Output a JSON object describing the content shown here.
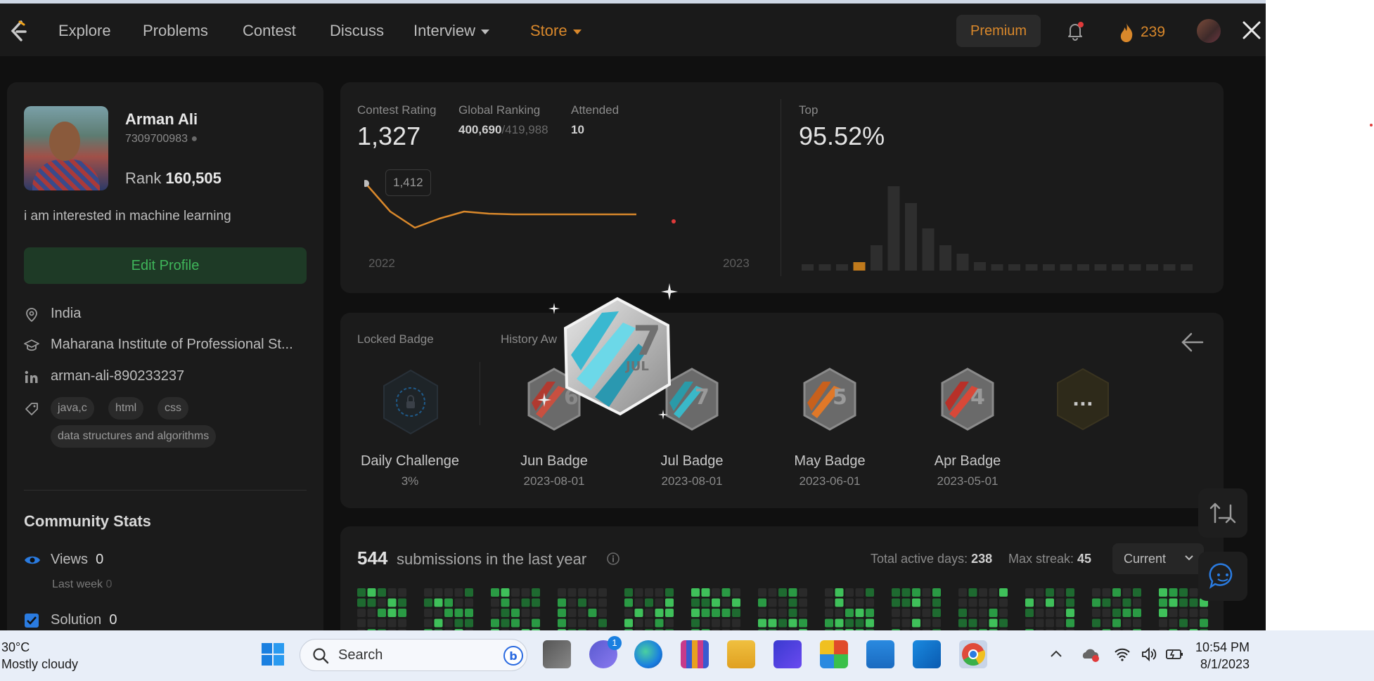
{
  "nav": {
    "items": [
      "Explore",
      "Problems",
      "Contest",
      "Discuss",
      "Interview",
      "Store"
    ],
    "premium": "Premium",
    "streak": "239"
  },
  "profile": {
    "name": "Arman Ali",
    "id": "7309700983",
    "rank_label": "Rank",
    "rank": "160,505",
    "bio": "i am interested in machine learning",
    "edit": "Edit Profile",
    "location": "India",
    "school": "Maharana Institute of Professional St...",
    "linkedin": "arman-ali-890233237",
    "tags": [
      "java,c",
      "html",
      "css",
      "data structures and algorithms"
    ],
    "community_title": "Community Stats",
    "views_label": "Views",
    "views": "0",
    "last_week": "Last week",
    "last_week_val": "0",
    "solution_label": "Solution",
    "solution": "0"
  },
  "contest": {
    "rating_label": "Contest Rating",
    "rating": "1,327",
    "ranking_label": "Global Ranking",
    "ranking": "400,690",
    "ranking_total": "/419,988",
    "attended_label": "Attended",
    "attended": "10",
    "top_label": "Top",
    "top": "95.52%",
    "tooltip": "1,412",
    "year_start": "2022",
    "year_end": "2023",
    "line_points": [
      1412,
      1372,
      1349,
      1362,
      1372,
      1369,
      1368,
      1368,
      1368,
      1368,
      1368,
      1368,
      1327
    ],
    "histogram": [
      1,
      1,
      1,
      2,
      6,
      20,
      16,
      10,
      6,
      4,
      2,
      1.5,
      1,
      1,
      1,
      1,
      1,
      1,
      1,
      1,
      1,
      1,
      1
    ],
    "histogram_highlight": 3,
    "accent": "#d9882b"
  },
  "badges": {
    "locked_label": "Locked Badge",
    "history_label": "History Aw",
    "items": [
      {
        "name": "Daily Challenge",
        "sub": "3%"
      },
      {
        "name": "Jun Badge",
        "sub": "2023-08-01",
        "num": "6"
      },
      {
        "name": "Jul Badge",
        "sub": "2023-08-01",
        "num": "7"
      },
      {
        "name": "May Badge",
        "sub": "2023-06-01",
        "num": "5"
      },
      {
        "name": "Apr Badge",
        "sub": "2023-05-01",
        "num": "4"
      }
    ],
    "more": "...",
    "popup_num": "7",
    "popup_month": "JUL"
  },
  "submissions": {
    "count": "544",
    "text": "submissions in the last year",
    "active_label": "Total active days:",
    "active": "238",
    "streak_label": "Max streak:",
    "streak": "45",
    "dropdown": "Current"
  },
  "taskbar": {
    "temp": "30°C",
    "weather": "Mostly cloudy",
    "search": "Search",
    "time": "10:54 PM",
    "date": "8/1/2023",
    "teams_badge": "1"
  }
}
